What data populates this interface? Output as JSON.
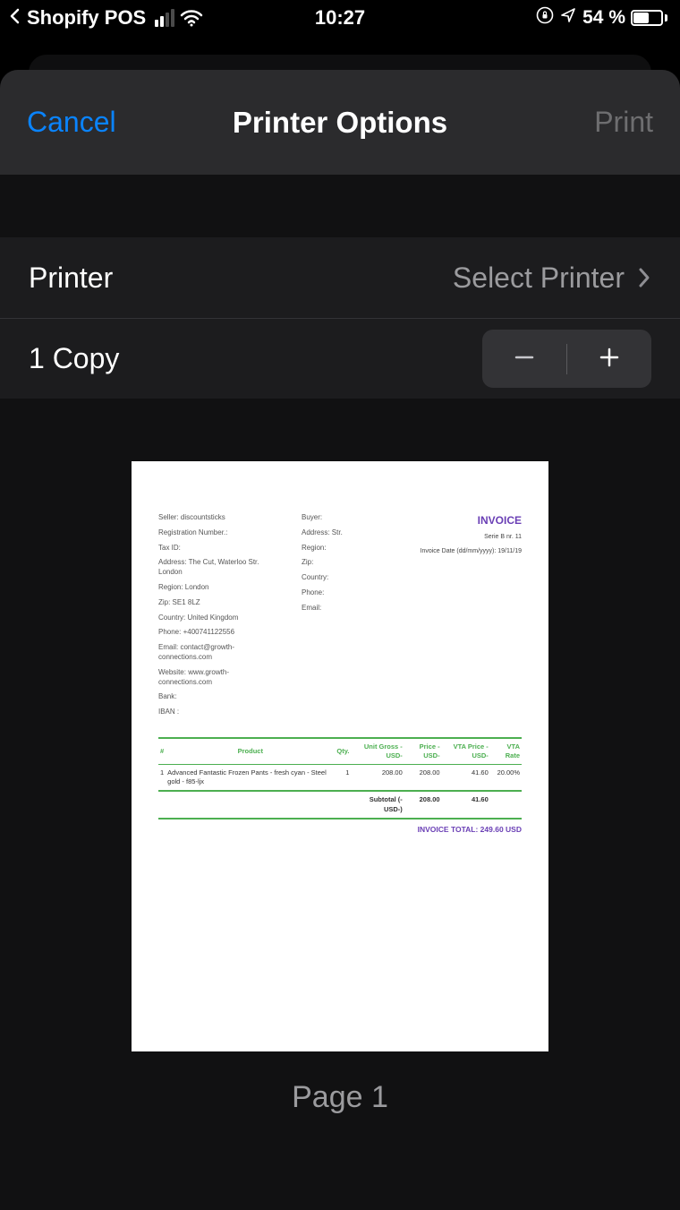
{
  "status_bar": {
    "back_app": "Shopify POS",
    "time": "10:27",
    "battery_pct": "54 %"
  },
  "nav": {
    "cancel": "Cancel",
    "title": "Printer Options",
    "print": "Print"
  },
  "rows": {
    "printer_label": "Printer",
    "printer_value": "Select Printer",
    "copies_label": "1 Copy"
  },
  "preview": {
    "page_label": "Page 1"
  },
  "invoice": {
    "seller": {
      "seller": "Seller: discountsticks",
      "reg": "Registration Number.:",
      "tax": "Tax ID:",
      "address": "Address: The Cut, Waterloo Str. London",
      "region": "Region: London",
      "zip": "Zip: SE1 8LZ",
      "country": "Country: United Kingdom",
      "phone": "Phone: +400741122556",
      "email": "Email: contact@growth-connections.com",
      "web": "Website: www.growth-connections.com",
      "bank": "Bank:",
      "iban": "IBAN :"
    },
    "buyer": {
      "buyer": "Buyer:",
      "address": "Address: Str.",
      "region": "Region:",
      "zip": "Zip:",
      "country": "Country:",
      "phone": "Phone:",
      "email": "Email:"
    },
    "header": {
      "title": "INVOICE",
      "serie": "Serie B nr. 11",
      "date": "Invoice Date (dd/mm/yyyy): 19/11/19"
    },
    "table": {
      "h_num": "#",
      "h_prod": "Product",
      "h_qty": "Qty.",
      "h_ug": "Unit Gross -USD-",
      "h_price": "Price -USD-",
      "h_vtap": "VTA Price -USD-",
      "h_vtar": "VTA Rate",
      "r_num": "1",
      "r_prod": "Advanced Fantastic Frozen Pants - fresh cyan - Steel gold - f85-ljx",
      "r_qty": "1",
      "r_ug": "208.00",
      "r_price": "208.00",
      "r_vtap": "41.60",
      "r_vtar": "20.00%",
      "sub_label": "Subtotal (-USD-)",
      "sub_price": "208.00",
      "sub_vtap": "41.60",
      "total": "INVOICE TOTAL: 249.60 USD"
    }
  }
}
